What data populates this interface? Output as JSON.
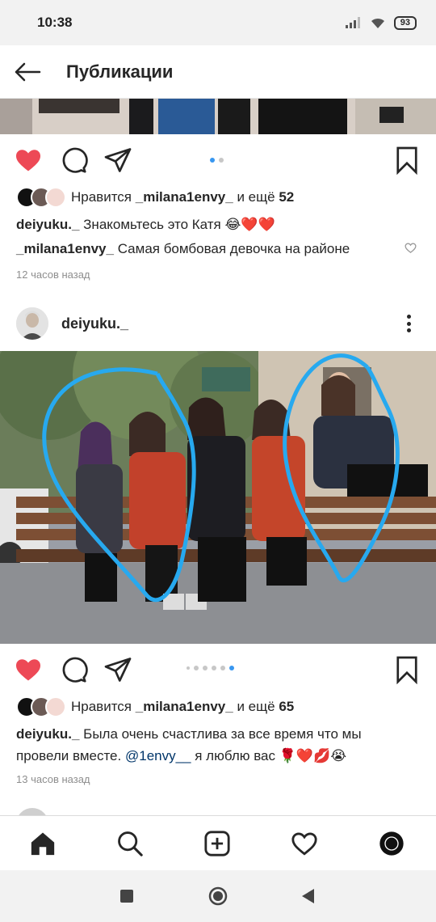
{
  "status_bar": {
    "time": "10:38",
    "battery": "93"
  },
  "header": {
    "title": "Публикации"
  },
  "post1": {
    "likes_prefix": "Нравится",
    "likes_user": "_milanа1envy_",
    "likes_suffix": "и ещё",
    "likes_count": "52",
    "caption_user": "deiyuku._",
    "caption_text": "Знакомьтесь это Катя 😂❤️❤️",
    "comment_user": "_milana1envy_",
    "comment_text": "Самая бомбовая девочка на районе",
    "time_ago": "12 часов назад",
    "carousel_index": 0,
    "carousel_count": 2
  },
  "post2": {
    "username": "deiyuku._",
    "likes_prefix": "Нравится",
    "likes_user": "_milana1envy_",
    "likes_suffix": "и ещё",
    "likes_count": "65",
    "caption_user": "deiyuku._",
    "caption_text": "Была очень счастлива за все время что мы провели вместе.",
    "caption_mention": "@1envy__",
    "caption_tail": "я люблю вас 🌹❤️💋😭",
    "time_ago": "13 часов назад",
    "carousel_index": 5,
    "carousel_count": 6
  },
  "icons": {
    "like_color": "#ed4956",
    "accent": "#3897f0"
  }
}
